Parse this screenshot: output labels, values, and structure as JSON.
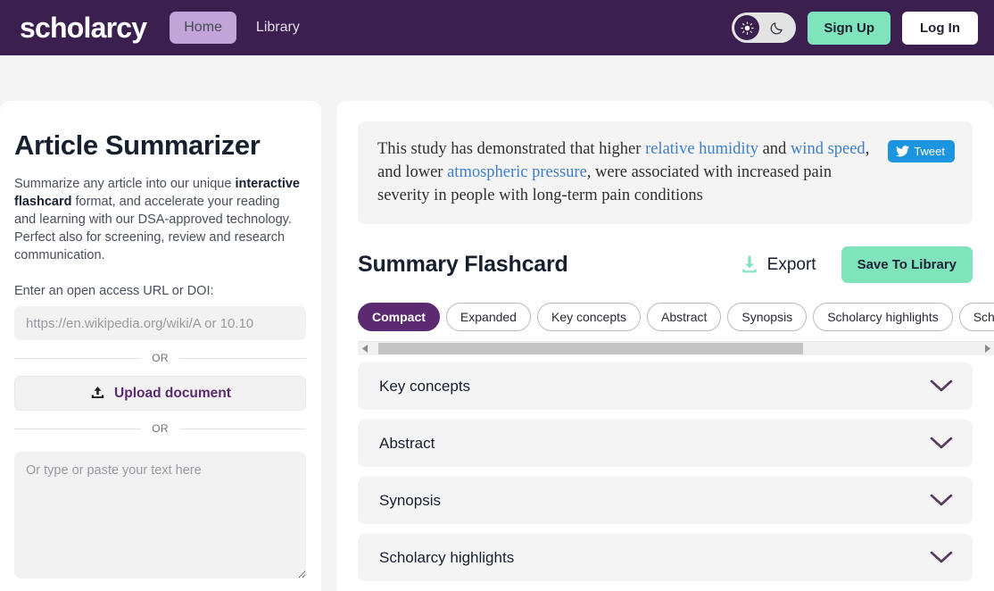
{
  "header": {
    "logo": "scholarcy",
    "nav": [
      {
        "label": "Home",
        "active": true
      },
      {
        "label": "Library",
        "active": false
      }
    ],
    "theme_toggle": {
      "sun_icon": "sun-icon",
      "moon_icon": "moon-icon",
      "active": "light"
    },
    "signup_label": "Sign Up",
    "login_label": "Log In",
    "bg_color": "#3a1f4f",
    "accent_green": "#7fe3bb",
    "nav_active_bg": "#c1a4d8"
  },
  "sidebar": {
    "title": "Article Summarizer",
    "intro_part1": "Summarize any article into our unique ",
    "intro_bold": "interactive flashcard",
    "intro_part2": " format, and accelerate your reading and learning with our DSA-approved technology. Perfect also for screening, review and research communication.",
    "url_label": "Enter an open access URL or DOI:",
    "url_placeholder": "https://en.wikipedia.org/wiki/A or 10.10",
    "url_value": "",
    "or_text_1": "OR",
    "or_text_2": "OR",
    "upload_label": "Upload document",
    "upload_icon": "upload-icon",
    "textarea_placeholder": "Or type or paste your text here",
    "textarea_value": ""
  },
  "main": {
    "quote": {
      "seg1": "This study has demonstrated that higher ",
      "link1": "relative humidity",
      "seg2": " and ",
      "link2": "wind speed",
      "seg3": ", and lower ",
      "link3": "atmospheric pressure",
      "seg4": ", were associated with increased pain severity in people with long-term pain conditions",
      "link_color": "#3d7fcc"
    },
    "tweet": {
      "label": "Tweet",
      "icon": "twitter-bird-icon",
      "color": "#1b95e0"
    },
    "flashcard_title": "Summary Flashcard",
    "export_label": "Export",
    "export_icon": "download-icon",
    "save_label": "Save To Library",
    "tabs": [
      {
        "label": "Compact",
        "active": true
      },
      {
        "label": "Expanded",
        "active": false
      },
      {
        "label": "Key concepts",
        "active": false
      },
      {
        "label": "Abstract",
        "active": false
      },
      {
        "label": "Synopsis",
        "active": false
      },
      {
        "label": "Scholarcy highlights",
        "active": false
      },
      {
        "label": "Scholarc",
        "active": false
      }
    ],
    "scrollbar": {
      "left_arrow": "chevron-left-icon",
      "right_arrow": "chevron-right-icon",
      "thumb_percent": 70
    },
    "sections": [
      {
        "label": "Key concepts",
        "icon": "chevron-down-icon"
      },
      {
        "label": "Abstract",
        "icon": "chevron-down-icon"
      },
      {
        "label": "Synopsis",
        "icon": "chevron-down-icon"
      },
      {
        "label": "Scholarcy highlights",
        "icon": "chevron-down-icon"
      }
    ]
  }
}
